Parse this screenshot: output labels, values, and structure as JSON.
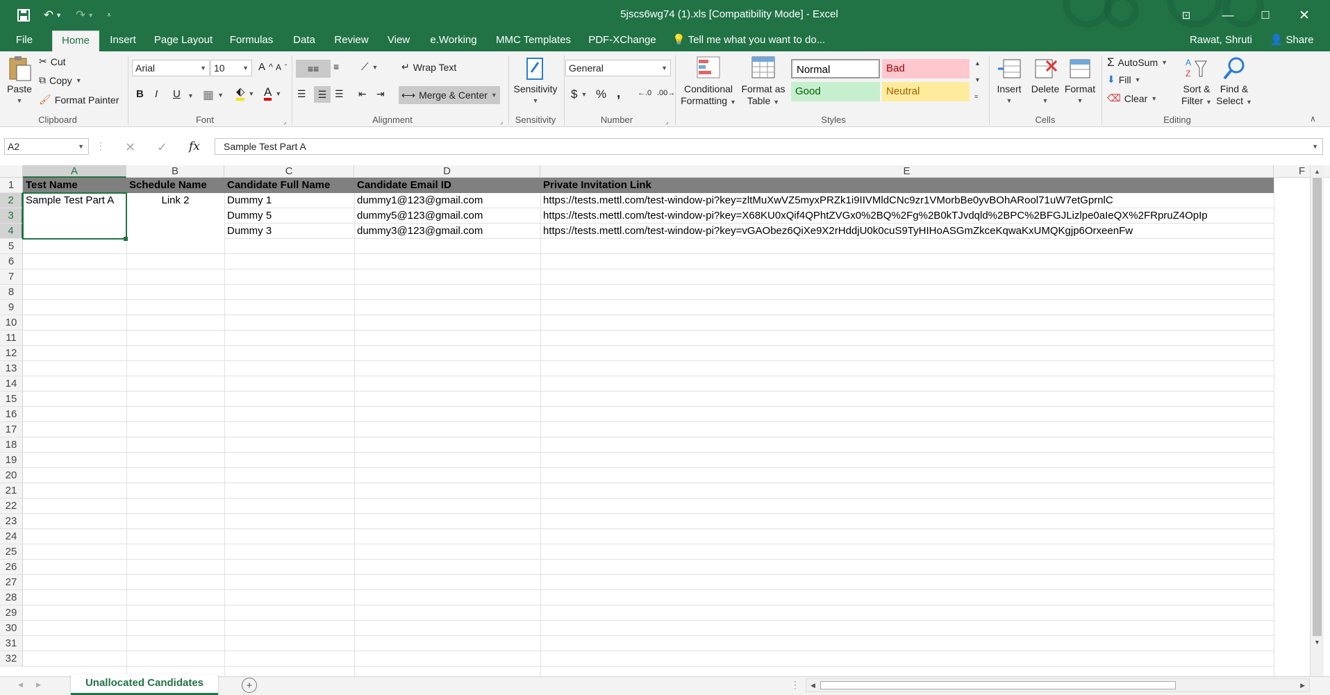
{
  "window": {
    "title": "5jscs6wg74 (1).xls  [Compatibility Mode] - Excel",
    "user": "Rawat, Shruti",
    "share": "Share"
  },
  "tabs": [
    "File",
    "Home",
    "Insert",
    "Page Layout",
    "Formulas",
    "Data",
    "Review",
    "View",
    "e.Working",
    "MMC Templates",
    "PDF-XChange"
  ],
  "tell_me": "Tell me what you want to do...",
  "clipboard": {
    "paste": "Paste",
    "cut": "Cut",
    "copy": "Copy",
    "format_painter": "Format Painter",
    "label": "Clipboard"
  },
  "font": {
    "name": "Arial",
    "size": "10",
    "bold": "B",
    "italic": "I",
    "underline": "U",
    "label": "Font"
  },
  "alignment": {
    "wrap": "Wrap Text",
    "merge": "Merge & Center",
    "label": "Alignment"
  },
  "sensitivity": {
    "button": "Sensitivity",
    "label": "Sensitivity"
  },
  "number": {
    "format": "General",
    "currency": "$",
    "percent": "%",
    "comma": ",",
    "label": "Number"
  },
  "styles": {
    "conditional_1": "Conditional",
    "conditional_2": "Formatting",
    "format_table_1": "Format as",
    "format_table_2": "Table",
    "normal": "Normal",
    "bad": "Bad",
    "good": "Good",
    "neutral": "Neutral",
    "label": "Styles"
  },
  "cells": {
    "insert": "Insert",
    "delete": "Delete",
    "format": "Format",
    "label": "Cells"
  },
  "editing": {
    "autosum": "AutoSum",
    "fill": "Fill",
    "clear": "Clear",
    "sort_1": "Sort &",
    "sort_2": "Filter",
    "find_1": "Find &",
    "find_2": "Select",
    "label": "Editing"
  },
  "formula_bar": {
    "name_box": "A2",
    "fx": "fx",
    "value": "Sample Test  Part A"
  },
  "columns": [
    "A",
    "B",
    "C",
    "D",
    "E",
    "F"
  ],
  "rows": [
    "1",
    "2",
    "3",
    "4",
    "5",
    "6",
    "7",
    "8",
    "9",
    "10",
    "11",
    "12",
    "13",
    "14",
    "15",
    "16",
    "17",
    "18",
    "19",
    "20",
    "21",
    "22",
    "23",
    "24",
    "25",
    "26",
    "27",
    "28",
    "29",
    "30",
    "31",
    "32"
  ],
  "headers": {
    "a": "Test Name",
    "b": "Schedule Name",
    "c": "Candidate Full Name",
    "d": "Candidate Email ID",
    "e": "Private Invitation Link"
  },
  "data": [
    {
      "a": "Sample Test  Part A",
      "b": "Link 2",
      "c": "Dummy 1",
      "d": "dummy1@123@gmail.com",
      "e": "https://tests.mettl.com/test-window-pi?key=zltMuXwVZ5myxPRZk1i9IIVMldCNc9zr1VMorbBe0yvBOhARool71uW7etGprnlC"
    },
    {
      "c": "Dummy 5",
      "d": "dummy5@123@gmail.com",
      "e": "https://tests.mettl.com/test-window-pi?key=X68KU0xQif4QPhtZVGx0%2BQ%2Fg%2B0kTJvdqld%2BPC%2BFGJLizlpe0aIeQX%2FRpruZ4OpIp"
    },
    {
      "c": "Dummy 3",
      "d": "dummy3@123@gmail.com",
      "e": "https://tests.mettl.com/test-window-pi?key=vGAObez6QiXe9X2rHddjU0k0cuS9TyHIHoASGmZkceKqwaKxUMQKgjp6OrxeenFw"
    }
  ],
  "sheet_tab": "Unallocated Candidates",
  "accent": "#217346"
}
